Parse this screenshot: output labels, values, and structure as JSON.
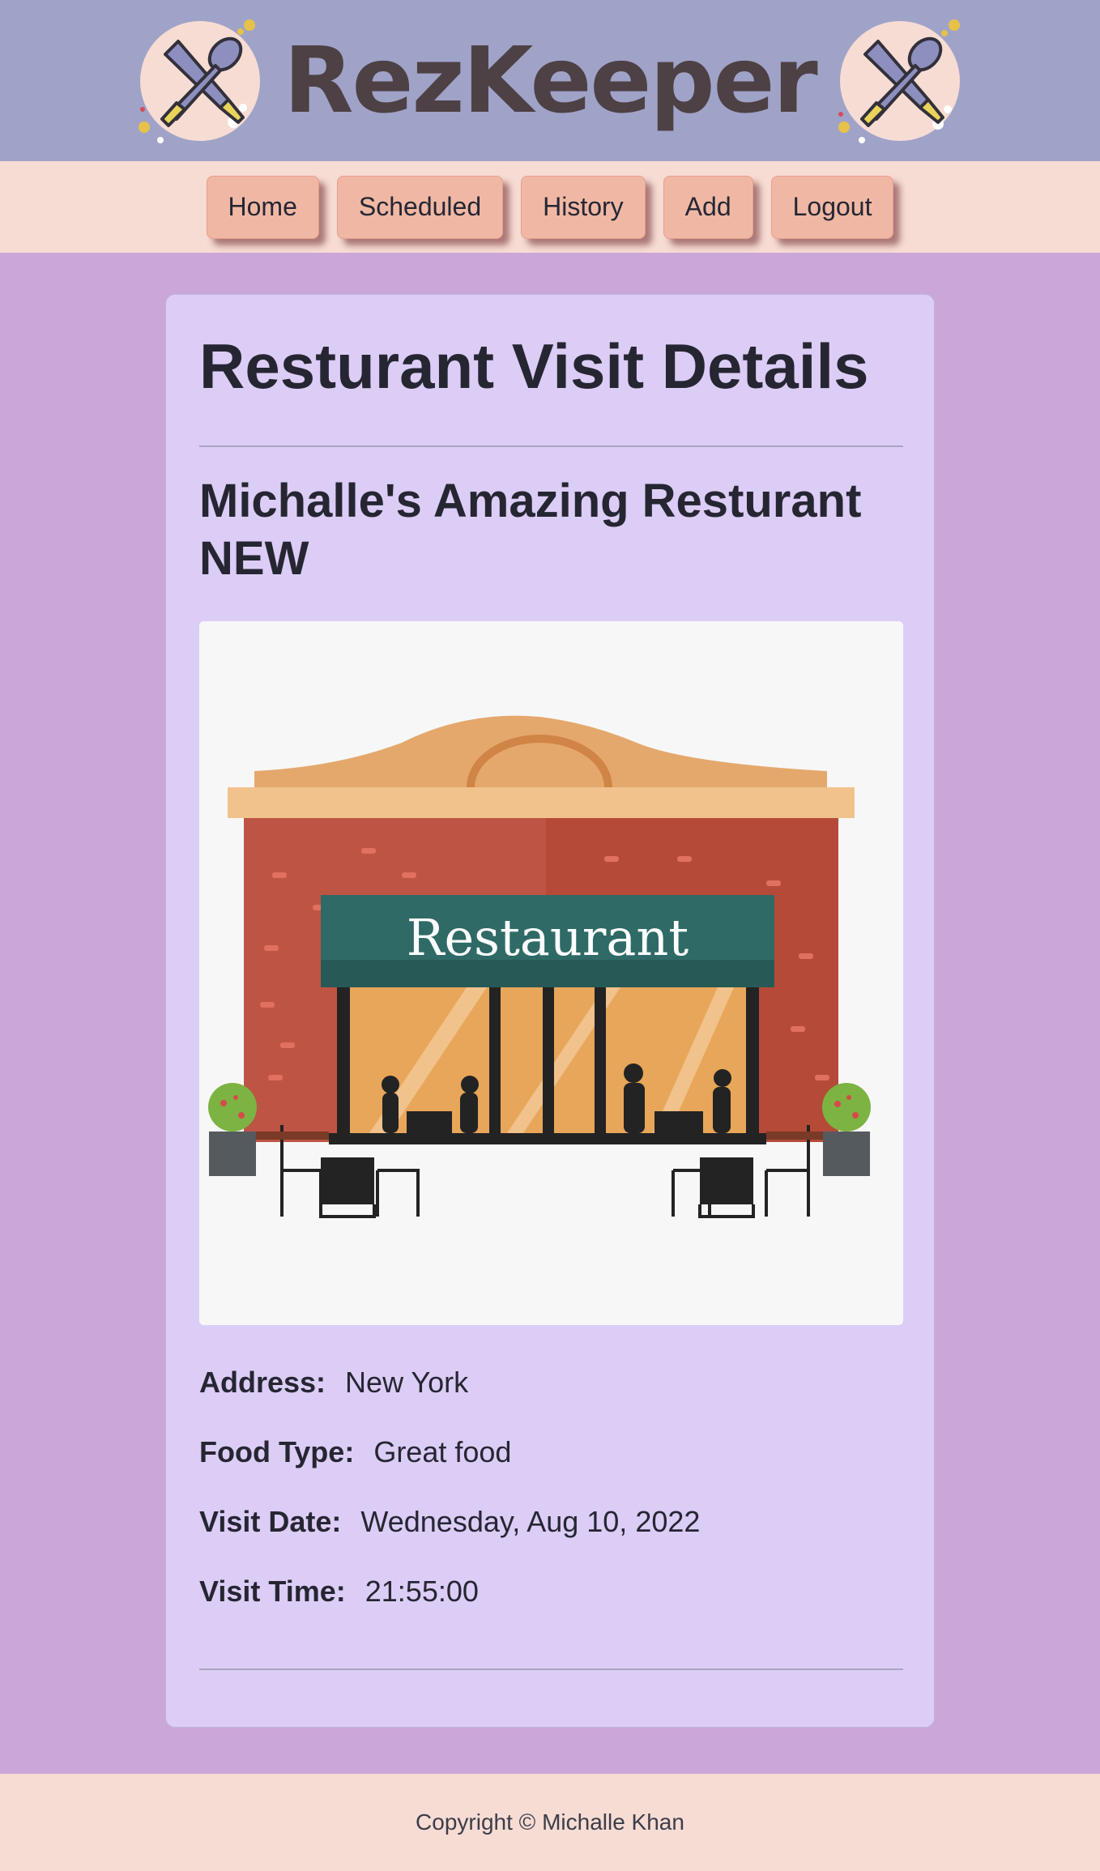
{
  "header": {
    "brand": "RezKeeper",
    "logo_icon": "crossed-spoon-knife-icon",
    "colors": {
      "header_bg": "#a0a3c8",
      "brand_text": "#4d4145",
      "logo_bg": "#f6dcd3"
    }
  },
  "nav": {
    "items": [
      {
        "label": "Home"
      },
      {
        "label": "Scheduled"
      },
      {
        "label": "History"
      },
      {
        "label": "Add"
      },
      {
        "label": "Logout"
      }
    ],
    "colors": {
      "bar_bg": "#f6dcd3",
      "button_bg": "#f0b8a4"
    }
  },
  "main": {
    "title": "Resturant Visit Details",
    "restaurant_name": "Michalle's Amazing Resturant NEW",
    "image": {
      "icon": "restaurant-storefront-illustration",
      "sign_text": "Restaurant"
    },
    "details": {
      "address_label": "Address:",
      "address": "New York",
      "food_type_label": "Food Type:",
      "food_type": "Great food",
      "visit_date_label": "Visit Date:",
      "visit_date": "Wednesday, Aug 10, 2022",
      "visit_time_label": "Visit Time:",
      "visit_time": "21:55:00"
    },
    "colors": {
      "page_bg": "#cba7d9",
      "card_bg": "#dccdf6"
    }
  },
  "footer": {
    "copyright": "Copyright © Michalle Khan"
  }
}
